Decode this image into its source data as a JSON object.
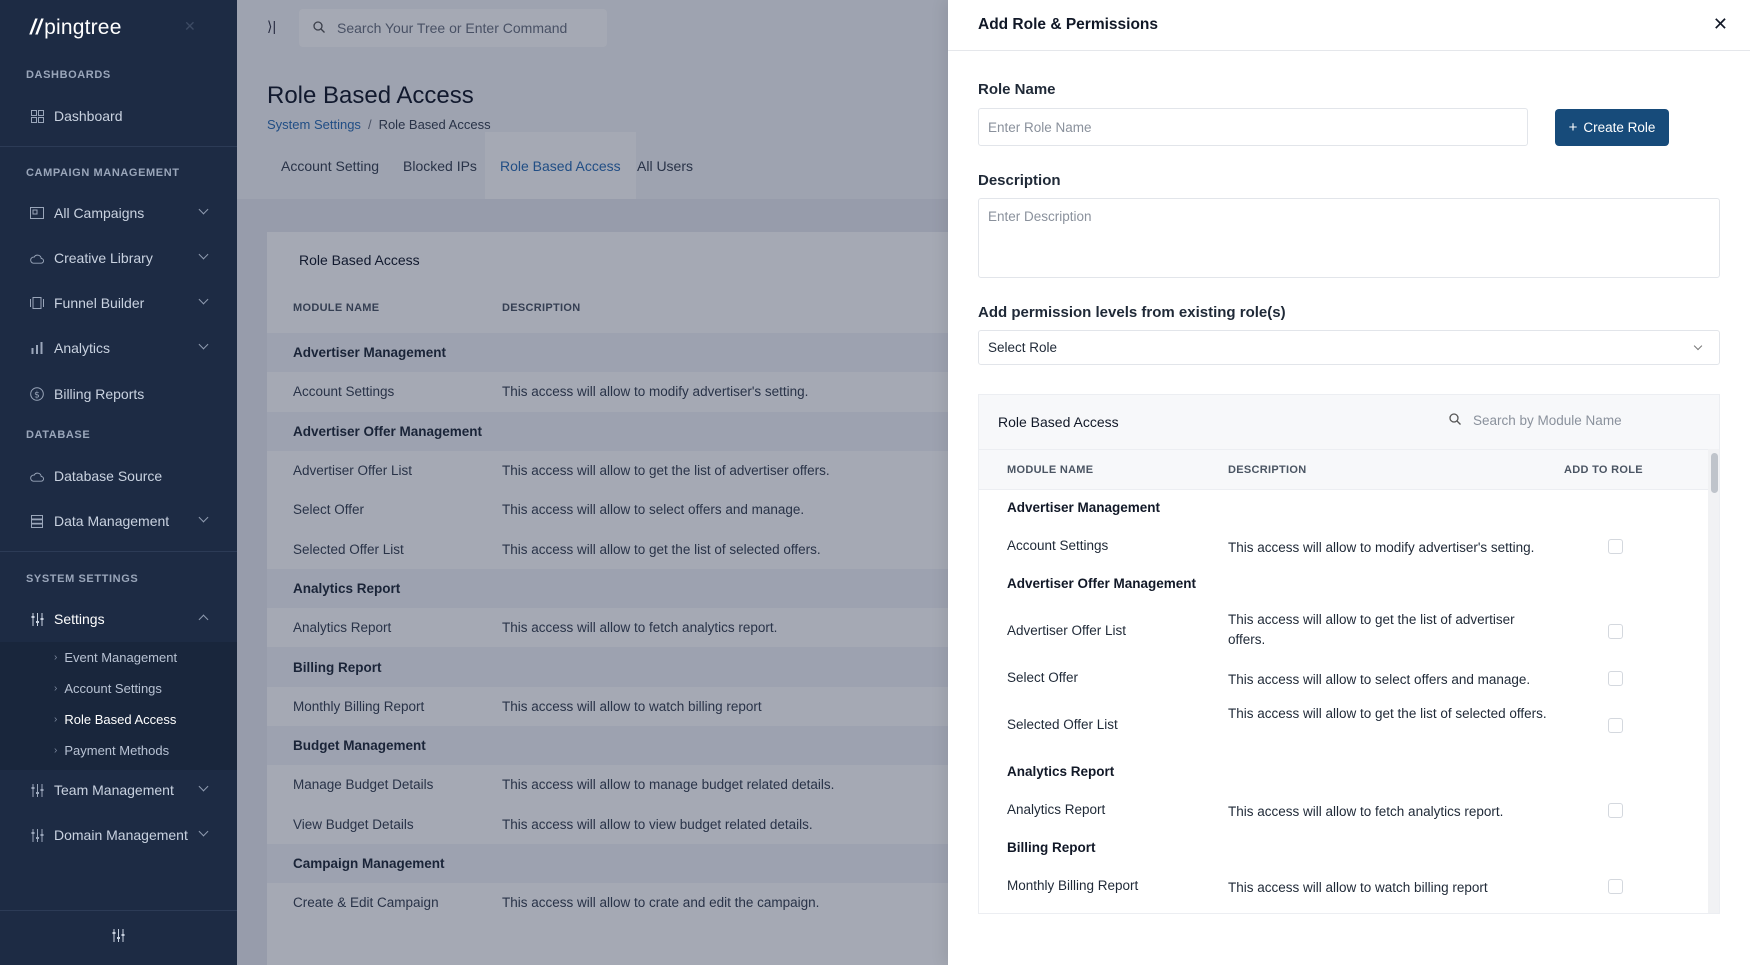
{
  "sidebar": {
    "logo": "pingtree",
    "sections": {
      "dashboards": "DASHBOARDS",
      "campaign": "CAMPAIGN MANAGEMENT",
      "database": "DATABASE",
      "system": "SYSTEM SETTINGS"
    },
    "items": {
      "dashboard": "Dashboard",
      "all_campaigns": "All Campaigns",
      "creative_library": "Creative Library",
      "funnel_builder": "Funnel Builder",
      "analytics": "Analytics",
      "billing_reports": "Billing Reports",
      "database_source": "Database Source",
      "data_management": "Data Management",
      "settings": "Settings",
      "team_management": "Team Management",
      "domain_management": "Domain Management"
    },
    "settings_sub": {
      "event": "Event Management",
      "account": "Account Settings",
      "rba": "Role Based Access",
      "payment": "Payment Methods"
    }
  },
  "topbar": {
    "search_placeholder": "Search Your Tree or Enter Command"
  },
  "page": {
    "title": "Role Based Access",
    "breadcrumb": {
      "parent": "System Settings",
      "sep": "/",
      "current": "Role Based Access"
    },
    "tabs": {
      "account": "Account Setting",
      "blocked": "Blocked IPs",
      "rba": "Role Based Access",
      "users": "All Users"
    },
    "card_title": "Role Based Access",
    "headers": {
      "module": "MODULE NAME",
      "description": "DESCRIPTION"
    },
    "rows": [
      {
        "type": "group",
        "name": "Advertiser Management",
        "desc": ""
      },
      {
        "type": "item",
        "name": "Account Settings",
        "desc": "This access will allow to modify advertiser's setting."
      },
      {
        "type": "group",
        "name": "Advertiser Offer Management",
        "desc": ""
      },
      {
        "type": "item",
        "name": "Advertiser Offer List",
        "desc": "This access will allow to get the list of advertiser offers."
      },
      {
        "type": "item",
        "name": "Select Offer",
        "desc": "This access will allow to select offers and manage."
      },
      {
        "type": "item",
        "name": "Selected Offer List",
        "desc": "This access will allow to get the list of selected offers."
      },
      {
        "type": "group",
        "name": "Analytics Report",
        "desc": ""
      },
      {
        "type": "item",
        "name": "Analytics Report",
        "desc": "This access will allow to fetch analytics report."
      },
      {
        "type": "group",
        "name": "Billing Report",
        "desc": ""
      },
      {
        "type": "item",
        "name": "Monthly Billing Report",
        "desc": "This access will allow to watch billing report"
      },
      {
        "type": "group",
        "name": "Budget Management",
        "desc": ""
      },
      {
        "type": "item",
        "name": "Manage Budget Details",
        "desc": "This access will allow to manage budget related details."
      },
      {
        "type": "item",
        "name": "View Budget Details",
        "desc": "This access will allow to view budget related details."
      },
      {
        "type": "group",
        "name": "Campaign Management",
        "desc": ""
      },
      {
        "type": "item",
        "name": "Create & Edit Campaign",
        "desc": "This access will allow to crate and edit the campaign."
      }
    ]
  },
  "drawer": {
    "title": "Add Role & Permissions",
    "role_name_label": "Role Name",
    "role_name_placeholder": "Enter Role Name",
    "create_button": "Create Role",
    "description_label": "Description",
    "description_placeholder": "Enter Description",
    "permission_label": "Add permission levels from existing role(s)",
    "select_value": "Select Role",
    "box_title": "Role Based Access",
    "box_search_placeholder": "Search by Module Name",
    "headers": {
      "module": "MODULE NAME",
      "description": "DESCRIPTION",
      "add": "ADD TO ROLE"
    },
    "rows": [
      {
        "type": "group",
        "name": "Advertiser Management",
        "desc": ""
      },
      {
        "type": "item",
        "name": "Account Settings",
        "desc": "This access will allow to modify advertiser's setting."
      },
      {
        "type": "group",
        "name": "Advertiser Offer Management",
        "desc": ""
      },
      {
        "type": "item",
        "name": "Advertiser Offer List",
        "desc": "This access will allow to get the list of advertiser offers."
      },
      {
        "type": "item",
        "name": "Select Offer",
        "desc": "This access will allow to select offers and manage."
      },
      {
        "type": "item",
        "name": "Selected Offer List",
        "desc": "This access will allow to get the list of selected offers."
      },
      {
        "type": "group",
        "name": "Analytics Report",
        "desc": ""
      },
      {
        "type": "item",
        "name": "Analytics Report",
        "desc": "This access will allow to fetch analytics report."
      },
      {
        "type": "group",
        "name": "Billing Report",
        "desc": ""
      },
      {
        "type": "item",
        "name": "Monthly Billing Report",
        "desc": "This access will allow to watch billing report"
      }
    ]
  },
  "colors": {
    "sidebar_bg": "#1d2b44",
    "primary": "#174b7a",
    "link": "#2a6cb3"
  }
}
